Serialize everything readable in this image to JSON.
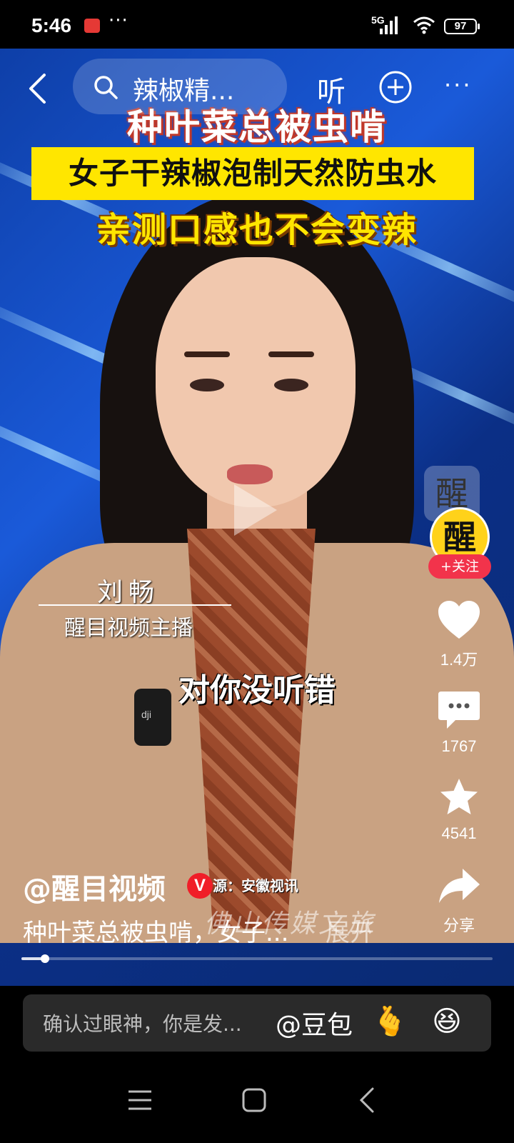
{
  "status_bar": {
    "time": "5:46",
    "more": "···",
    "network": "5G",
    "battery": "97"
  },
  "top_bar": {
    "search_text": "辣椒精...",
    "listen_label": "听",
    "more_label": "···"
  },
  "headline": {
    "line1": "种叶菜总被虫啃",
    "line2": "女子干辣椒泡制天然防虫水",
    "line3": "亲测口感也不会变辣"
  },
  "anchor": {
    "name": "刘畅",
    "title": "醒目视频主播",
    "subtitle": "对你没听错",
    "mic_brand": "dji"
  },
  "sidebar": {
    "channel_glyph": "醒",
    "avatar_glyph": "醒",
    "follow_label": "+关注",
    "likes": "1.4万",
    "comments": "1767",
    "favorites": "4541",
    "share_label": "分享"
  },
  "bottom": {
    "author": "@醒目视频",
    "verified_badge": "V",
    "source": "源：安徽视讯",
    "watermark": "佛山传媒文旅",
    "caption": "种叶菜总被虫啃，女子...",
    "expand_label": "展开",
    "progress": 0.05
  },
  "comment_bar": {
    "placeholder": "确认过眼神，你是发...",
    "mention": "@豆包",
    "emoji_1": "🫰",
    "emoji_2": "😆"
  },
  "colors": {
    "video_bg": "#1a5ad9",
    "headline_yellow": "#ffe600",
    "follow_red": "#f2334b",
    "badge_red": "#f01e28"
  }
}
